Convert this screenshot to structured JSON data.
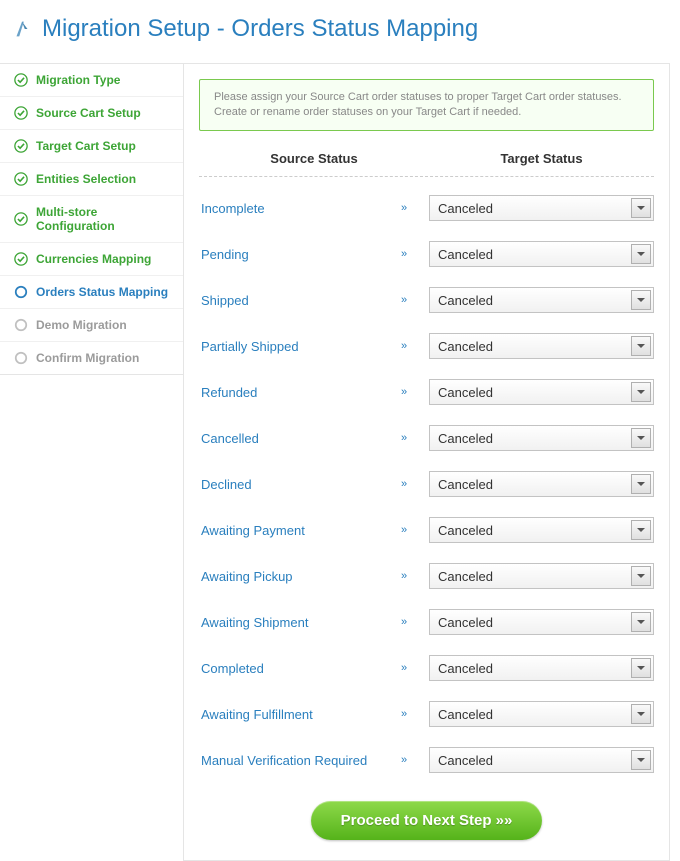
{
  "header": {
    "title": "Migration Setup - Orders Status Mapping"
  },
  "sidebar": {
    "items": [
      {
        "label": "Migration Type",
        "state": "done"
      },
      {
        "label": "Source Cart Setup",
        "state": "done"
      },
      {
        "label": "Target Cart Setup",
        "state": "done"
      },
      {
        "label": "Entities Selection",
        "state": "done"
      },
      {
        "label": "Multi-store Configuration",
        "state": "done"
      },
      {
        "label": "Currencies Mapping",
        "state": "done"
      },
      {
        "label": "Orders Status Mapping",
        "state": "current"
      },
      {
        "label": "Demo Migration",
        "state": "future"
      },
      {
        "label": "Confirm Migration",
        "state": "future"
      }
    ]
  },
  "info": {
    "line1": "Please assign your Source Cart order statuses to proper Target Cart order statuses.",
    "line2": "Create or rename order statuses on your Target Cart if needed."
  },
  "columns": {
    "source": "Source Status",
    "target": "Target Status"
  },
  "arrow_glyph": "»",
  "mappings": [
    {
      "source": "Incomplete",
      "target": "Canceled"
    },
    {
      "source": "Pending",
      "target": "Canceled"
    },
    {
      "source": "Shipped",
      "target": "Canceled"
    },
    {
      "source": "Partially Shipped",
      "target": "Canceled"
    },
    {
      "source": "Refunded",
      "target": "Canceled"
    },
    {
      "source": "Cancelled",
      "target": "Canceled"
    },
    {
      "source": "Declined",
      "target": "Canceled"
    },
    {
      "source": "Awaiting Payment",
      "target": "Canceled"
    },
    {
      "source": "Awaiting Pickup",
      "target": "Canceled"
    },
    {
      "source": "Awaiting Shipment",
      "target": "Canceled"
    },
    {
      "source": "Completed",
      "target": "Canceled"
    },
    {
      "source": "Awaiting Fulfillment",
      "target": "Canceled"
    },
    {
      "source": "Manual Verification Required",
      "target": "Canceled"
    }
  ],
  "proceed_label": "Proceed to Next Step »»",
  "colors": {
    "brand_blue": "#2A7FBE",
    "done_green": "#3DA536",
    "proceed_green": "#6ec52c"
  }
}
